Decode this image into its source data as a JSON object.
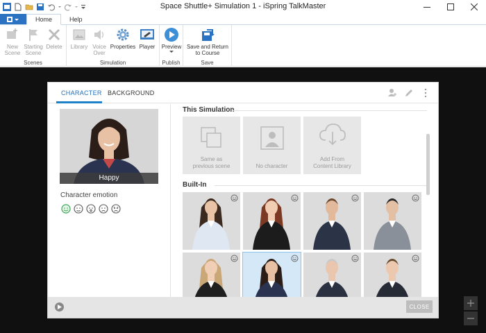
{
  "window": {
    "title": "Space Shuttle+ Simulation 1 - iSpring TalkMaster",
    "minimize": "—",
    "maximize": "☐",
    "close": "✕"
  },
  "ribbon": {
    "tabs": [
      {
        "label": "Home",
        "active": true
      },
      {
        "label": "Help",
        "active": false
      }
    ],
    "groups": {
      "scenes": {
        "label": "Scenes",
        "buttons": [
          {
            "label": "New\nScene",
            "icon": "new-scene-icon",
            "disabled": true
          },
          {
            "label": "Starting\nScene",
            "icon": "flag-icon",
            "disabled": true
          },
          {
            "label": "Delete",
            "icon": "delete-icon",
            "disabled": true
          }
        ]
      },
      "simulation": {
        "label": "Simulation",
        "buttons": [
          {
            "label": "Library",
            "icon": "image-icon",
            "disabled": true
          },
          {
            "label": "Voice\nOver",
            "icon": "speaker-icon",
            "disabled": true
          },
          {
            "label": "Properties",
            "icon": "gear-icon",
            "disabled": false
          },
          {
            "label": "Player",
            "icon": "player-icon",
            "disabled": false
          }
        ]
      },
      "publish": {
        "label": "Publish",
        "buttons": [
          {
            "label": "Preview",
            "icon": "play-icon",
            "disabled": false
          }
        ]
      },
      "save": {
        "label": "Save",
        "buttons": [
          {
            "label": "Save and Return\nto Course",
            "icon": "save-return-icon",
            "disabled": false
          }
        ]
      }
    }
  },
  "dialog": {
    "tabs": [
      {
        "label": "CHARACTER",
        "active": true
      },
      {
        "label": "BACKGROUND",
        "active": false
      }
    ],
    "preview_emotion_label": "Happy",
    "emotion_title": "Character emotion",
    "emotions": [
      "happy",
      "neutral",
      "surprised",
      "sad",
      "angry"
    ],
    "selected_emotion": "happy",
    "sections": {
      "this_simulation": "This Simulation",
      "built_in": "Built-In"
    },
    "simulation_tiles": [
      {
        "label": "Same as\nprevious scene",
        "icon": "copy-icon"
      },
      {
        "label": "No character",
        "icon": "person-icon"
      },
      {
        "label": "Add From\nContent Library",
        "icon": "cloud-download-icon"
      }
    ],
    "characters": [
      {
        "name": "woman-light-blue-shirt",
        "hair": "#3b2a20",
        "top": "#dfe8f2",
        "skin": "#e9c3a6",
        "selected": false
      },
      {
        "name": "woman-red-hair-black-suit",
        "hair": "#7c3a24",
        "top": "#1c1c1c",
        "skin": "#f0cdb3",
        "selected": false
      },
      {
        "name": "man-beard-navy-suit",
        "hair": "#6e4a30",
        "top": "#2b3446",
        "skin": "#e3b99b",
        "selected": false
      },
      {
        "name": "man-grey-suit-blue-shirt",
        "hair": "#2a2a2a",
        "top": "#8a9099",
        "skin": "#e3bfa4",
        "selected": false
      },
      {
        "name": "woman-blonde-black-suit",
        "hair": "#c9a777",
        "top": "#1f1f1f",
        "skin": "#f0cfb6",
        "selected": false
      },
      {
        "name": "woman-navy-suit",
        "hair": "#2b1e18",
        "top": "#2a3350",
        "skin": "#e8c1a5",
        "selected": true
      },
      {
        "name": "man-grey-hair-suit",
        "hair": "#c9c9c9",
        "top": "#2b3140",
        "skin": "#e9c6ad",
        "selected": false
      },
      {
        "name": "man-young-dark-suit",
        "hair": "#6a4b2f",
        "top": "#262b36",
        "skin": "#ecc8ae",
        "selected": false
      }
    ],
    "close_label": "CLOSE"
  },
  "colors": {
    "accent": "#1f82c9",
    "file_button": "#2b72c2",
    "workarea": "#101010",
    "happy_green": "#3aa655"
  }
}
